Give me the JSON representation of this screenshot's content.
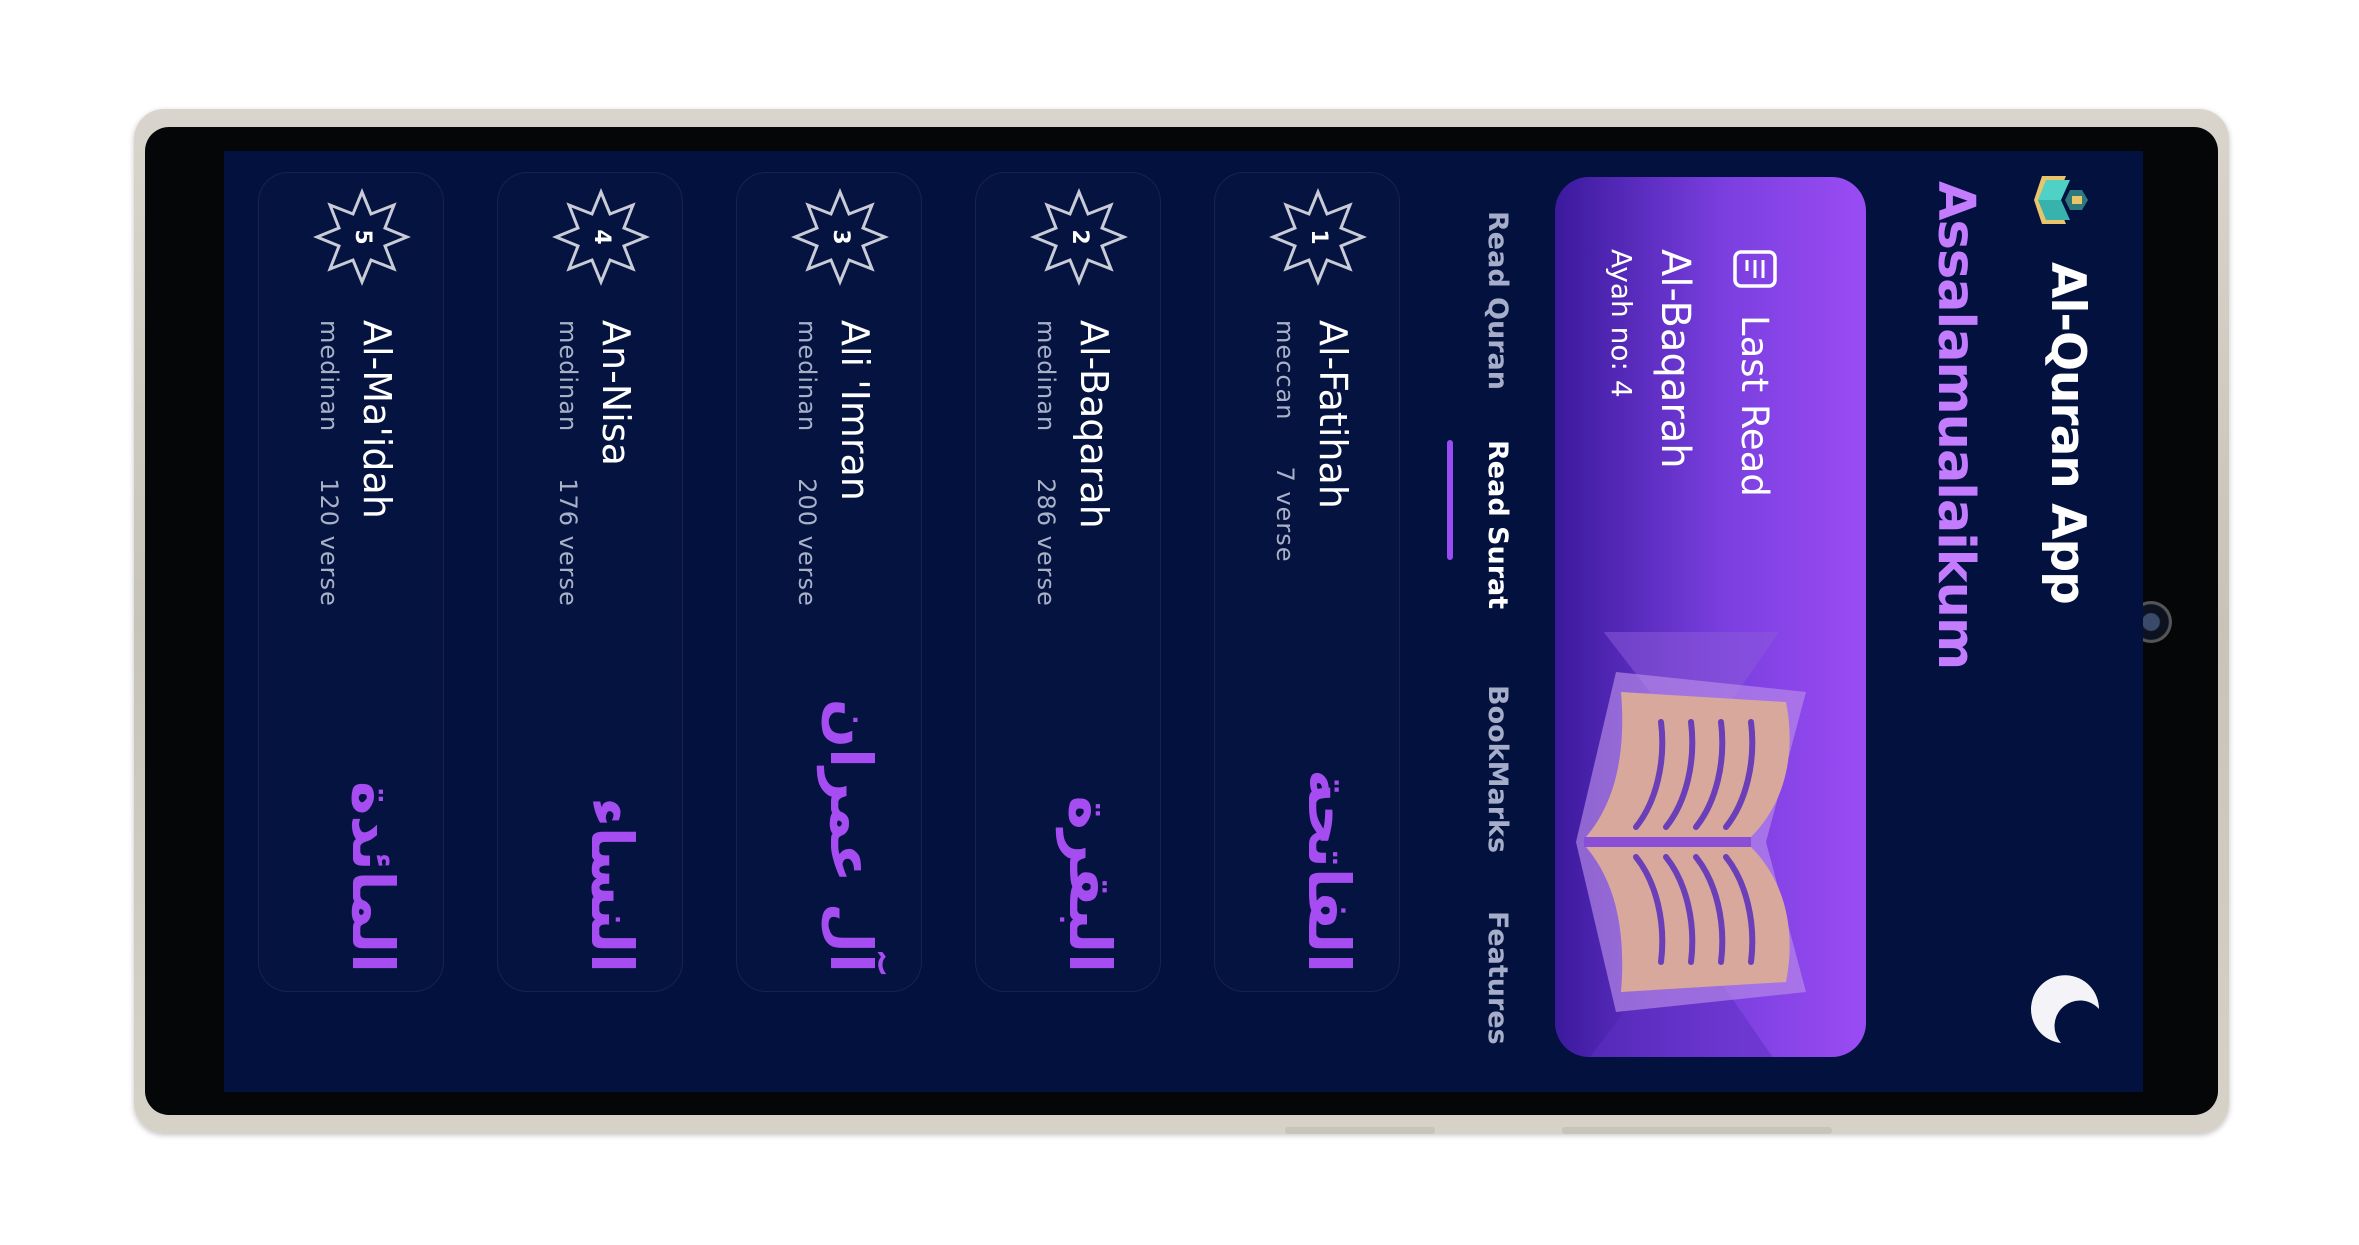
{
  "app": {
    "title": "Al-Quran App",
    "greeting": "Assalamualaikum"
  },
  "last_read": {
    "label": "Last Read",
    "surah": "Al-Baqarah",
    "ayah": "Ayah no: 4"
  },
  "tabs": [
    {
      "label": "Read Quran",
      "active": false
    },
    {
      "label": "Read Surat",
      "active": true
    },
    {
      "label": "BookMarks",
      "active": false
    },
    {
      "label": "Features",
      "active": false
    }
  ],
  "surahs": [
    {
      "number": "1",
      "name": "Al-Fatihah",
      "type": "meccan",
      "verses": "7 verse",
      "arabic": "الفاتحة"
    },
    {
      "number": "2",
      "name": "Al-Baqarah",
      "type": "medinan",
      "verses": "286 verse",
      "arabic": "البقرة"
    },
    {
      "number": "3",
      "name": "Ali 'Imran",
      "type": "medinan",
      "verses": "200 verse",
      "arabic": "آل عمران"
    },
    {
      "number": "4",
      "name": "An-Nisa",
      "type": "medinan",
      "verses": "176 verse",
      "arabic": "النساء"
    },
    {
      "number": "5",
      "name": "Al-Ma'idah",
      "type": "medinan",
      "verses": "120 verse",
      "arabic": "المائدة"
    }
  ],
  "icons": {
    "logo": "quran-book-logo-icon",
    "theme": "moon-icon",
    "last_read": "book-open-icon",
    "badge": "octagram-badge-icon"
  },
  "colors": {
    "background": "#03113f",
    "accent": "#9a4cf3",
    "greeting": "#c47cff",
    "arabic_text": "#a64df2"
  }
}
